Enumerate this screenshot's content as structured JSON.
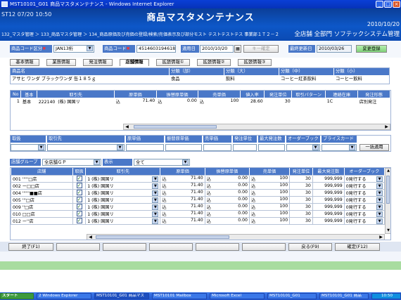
{
  "window": {
    "title": "MST10101_G01 商品マスタメンテナンス - Windows Internet Explorer"
  },
  "header": {
    "screen_id": "ST12",
    "date_time": "07/20 10:50",
    "title": "商品マスタメンテナンス",
    "right_date": "2010/10/20",
    "breadcrumb": "132_マスタ管理 ＞ 133_商品マスタ管理 ＞ 134_商品原価及び売価の登録/検索/売価表示及び部分モスト テストテストテス 事業部１Ｔ２－２",
    "org_unit": "全店舗 全部門 ソフテックシステム管理"
  },
  "search": {
    "code_type_label": "商品コード区分",
    "code_type_value": "JAN13桁",
    "product_code_label": "商品コード",
    "product_code_value": "4514603194618",
    "apply_date_label": "適用日",
    "apply_date_value": "2010/10/20",
    "confirm_button": "キー確定",
    "last_update_label": "最終更新日",
    "last_update_value": "2010/03/26",
    "change_reg_button": "変更登録"
  },
  "tabs": [
    "基本情報",
    "業態情報",
    "発注情報",
    "店舗情報",
    "拡張情報①",
    "拡張情報②",
    "拡張情報③"
  ],
  "active_tab": "店舗情報",
  "product": {
    "headers": [
      "商品名",
      "分類（部）",
      "分類（大）",
      "分類（中）",
      "分類（小）"
    ],
    "values": [
      "アサヒ ワンダ ブラックワンダ 缶１８５ｇ",
      "食品",
      "飲料",
      "コーヒー紅茶飲料",
      "コーヒー飲料"
    ]
  },
  "basic_grid": {
    "headers": [
      "No",
      "基本",
      "取引先",
      "原単価",
      "振替原単価",
      "売単価",
      "値入率",
      "発注単位",
      "取引パターン",
      "連絡在庫",
      "発注形態"
    ],
    "rows": [
      [
        "1",
        "基本",
        "222140",
        "(株) 国国リ",
        "込",
        "71.40",
        "込",
        "0.00",
        "込",
        "100",
        "28.60",
        "30",
        "",
        "1C",
        "店別発注"
      ]
    ]
  },
  "bulk": {
    "headers": [
      "取扱",
      "取引先",
      "原単価",
      "振替原単価",
      "売単価",
      "発注単位",
      "最大発注数",
      "オーダーブック",
      "プライスカード"
    ],
    "apply_button": "一括適用"
  },
  "store_filter": {
    "group_label": "店舗グループ",
    "group_value": "全店舗ＧＰ",
    "display_label": "表示",
    "display_value": "全て"
  },
  "store_grid": {
    "headers": [
      "店舗",
      "取扱",
      "取引先",
      "原単価",
      "振替原単価",
      "売単価",
      "発注単位",
      "最大発注数",
      "オーダーブック"
    ],
    "rows": [
      {
        "code": "001",
        "name": "'''''□店",
        "vendor": "1 (株) 国国リ",
        "cost": "71.40",
        "transfer": "0.00",
        "price": "100",
        "unit": "30",
        "max": "999,999",
        "book": "0発行する"
      },
      {
        "code": "002",
        "name": "ー□□店",
        "vendor": "1 (株) 国国リ",
        "cost": "71.40",
        "transfer": "0.00",
        "price": "100",
        "unit": "30",
        "max": "999,999",
        "book": "0発行する"
      },
      {
        "code": "004",
        "name": "''''''■■店",
        "vendor": "1 (株) 国国リ",
        "cost": "71.40",
        "transfer": "0.00",
        "price": "100",
        "unit": "30",
        "max": "999,999",
        "book": "0発行する"
      },
      {
        "code": "005",
        "name": "'''□店",
        "vendor": "1 (株) 国国リ",
        "cost": "71.40",
        "transfer": "0.00",
        "price": "100",
        "unit": "30",
        "max": "999,999",
        "book": "0発行する"
      },
      {
        "code": "009",
        "name": "''□店",
        "vendor": "1 (株) 国国リ",
        "cost": "71.40",
        "transfer": "0.00",
        "price": "100",
        "unit": "30",
        "max": "999,999",
        "book": "0発行する"
      },
      {
        "code": "010",
        "name": "□□店",
        "vendor": "1 (株) 国国リ",
        "cost": "71.40",
        "transfer": "0.00",
        "price": "100",
        "unit": "30",
        "max": "999,999",
        "book": "0発行する"
      },
      {
        "code": "012",
        "name": "ー''店",
        "vendor": "1 (株) 国国リ",
        "cost": "71.40",
        "transfer": "0.00",
        "price": "100",
        "unit": "30",
        "max": "999,999",
        "book": "0発行する"
      }
    ],
    "tax_mark": "込"
  },
  "footer": {
    "end": "終了(F1)",
    "back": "戻る(F9)",
    "ok": "確定(F12)"
  },
  "taskbar": {
    "items": [
      "スタート",
      "2 Windows Explorer",
      "MST10101_G01 商品マス",
      "MST10101 Mailbox",
      "Microsoft Excel",
      "MST10101_G01",
      "MST10101_G01 商品"
    ],
    "clock": "10:50"
  },
  "colors": {
    "header_blue": "#0d57c8",
    "label_blue": "#4a78c8",
    "status_green": "#a8dca0"
  }
}
